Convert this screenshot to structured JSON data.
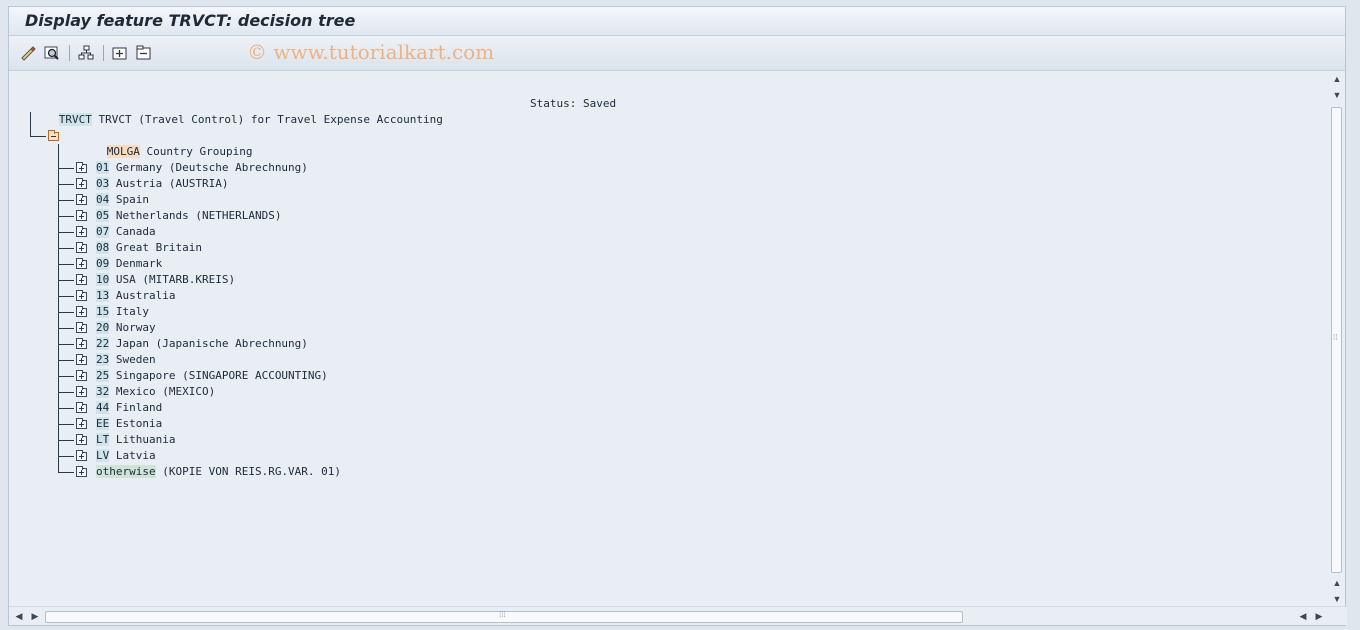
{
  "window": {
    "title": "Display feature TRVCT: decision tree"
  },
  "watermark": "© www.tutorialkart.com",
  "toolbar": {
    "buttons": [
      {
        "name": "edit-icon"
      },
      {
        "name": "find-icon"
      },
      {
        "name": "hierarchy-icon"
      },
      {
        "name": "expand-icon"
      },
      {
        "name": "collapse-icon"
      }
    ]
  },
  "tree": {
    "root": {
      "key": "TRVCT",
      "label": " TRVCT (Travel Control) for Travel Expense Accounting",
      "status": "Status: Saved"
    },
    "field": {
      "key": "MOLGA",
      "label": " Country Grouping"
    },
    "nodes": [
      {
        "key": "01",
        "label": " Germany (Deutsche Abrechnung)"
      },
      {
        "key": "03",
        "label": " Austria (AUSTRIA)"
      },
      {
        "key": "04",
        "label": " Spain"
      },
      {
        "key": "05",
        "label": " Netherlands (NETHERLANDS)"
      },
      {
        "key": "07",
        "label": " Canada"
      },
      {
        "key": "08",
        "label": " Great Britain"
      },
      {
        "key": "09",
        "label": " Denmark"
      },
      {
        "key": "10",
        "label": " USA (MITARB.KREIS)"
      },
      {
        "key": "13",
        "label": " Australia"
      },
      {
        "key": "15",
        "label": " Italy"
      },
      {
        "key": "20",
        "label": " Norway"
      },
      {
        "key": "22",
        "label": " Japan (Japanische Abrechnung)"
      },
      {
        "key": "23",
        "label": " Sweden"
      },
      {
        "key": "25",
        "label": " Singapore (SINGAPORE ACCOUNTING)"
      },
      {
        "key": "32",
        "label": " Mexico (MEXICO)"
      },
      {
        "key": "44",
        "label": " Finland"
      },
      {
        "key": "EE",
        "label": " Estonia"
      },
      {
        "key": "LT",
        "label": " Lithuania"
      },
      {
        "key": "LV",
        "label": " Latvia"
      },
      {
        "key": "otherwise",
        "label": " (KOPIE VON REIS.RG.VAR. 01)"
      }
    ]
  }
}
